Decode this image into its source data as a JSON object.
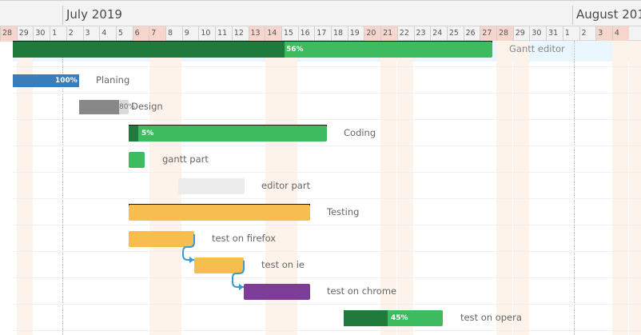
{
  "timeline": {
    "months": [
      {
        "label": "July 2019"
      },
      {
        "label": "August 201"
      }
    ],
    "days": [
      "28",
      "29",
      "30",
      "1",
      "2",
      "3",
      "4",
      "5",
      "6",
      "7",
      "8",
      "9",
      "10",
      "11",
      "12",
      "13",
      "14",
      "15",
      "16",
      "17",
      "18",
      "19",
      "20",
      "21",
      "22",
      "23",
      "24",
      "25",
      "26",
      "27",
      "28",
      "29",
      "30",
      "31",
      "1",
      "2",
      "3",
      "4"
    ],
    "weekend_flags": [
      true,
      false,
      false,
      false,
      false,
      false,
      false,
      false,
      true,
      true,
      false,
      false,
      false,
      false,
      false,
      true,
      true,
      false,
      false,
      false,
      false,
      false,
      true,
      true,
      false,
      false,
      false,
      false,
      false,
      true,
      true,
      false,
      false,
      false,
      false,
      false,
      true,
      true
    ]
  },
  "tasks": [
    {
      "name": "Gantt editor",
      "progress": "56%",
      "color": "#3dbb5e",
      "progress_color": "#1f7a3b"
    },
    {
      "name": "Planing",
      "progress": "100%",
      "color": "#5aaee8",
      "progress_color": "#3a7dbb"
    },
    {
      "name": "Design",
      "progress": "80%",
      "color": "#d9d9d9",
      "progress_color": "#888888"
    },
    {
      "name": "Coding",
      "progress": "5%",
      "color": "#3dbb5e",
      "progress_color": "#1f7a3b"
    },
    {
      "name": "gantt part",
      "progress": "",
      "color": "#3dbb5e",
      "progress_color": ""
    },
    {
      "name": "editor part",
      "progress": "",
      "color": "#ececec",
      "progress_color": ""
    },
    {
      "name": "Testing",
      "progress": "",
      "color": "#f7be4f",
      "progress_color": ""
    },
    {
      "name": "test on firefox",
      "progress": "",
      "color": "#f7be4f",
      "progress_color": ""
    },
    {
      "name": "test on ie",
      "progress": "",
      "color": "#f7be4f",
      "progress_color": ""
    },
    {
      "name": "test on chrome",
      "progress": "",
      "color": "#7d3c98",
      "progress_color": ""
    },
    {
      "name": "test on opera",
      "progress": "45%",
      "color": "#3dbb5e",
      "progress_color": "#1f7a3b"
    }
  ],
  "link_color": "#3a9ad9"
}
